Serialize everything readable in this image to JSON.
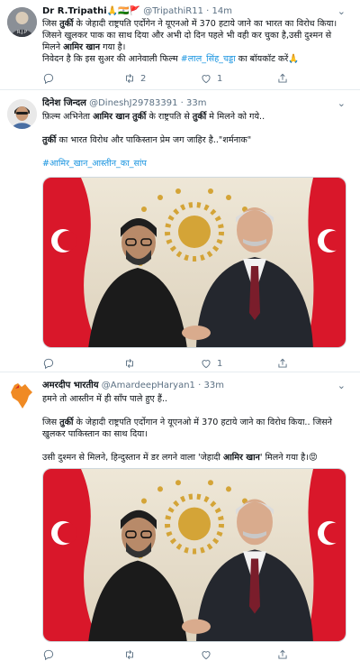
{
  "tweets": [
    {
      "name": "Dr R.Tripathi",
      "name_emoji": "🙏🇮🇳🚩",
      "handle": "@TripathiR11",
      "dot": "·",
      "time": "14m",
      "lines": [
        [
          "जिस ",
          {
            "b": "तुर्की"
          },
          " के जेहादी राष्ट्रपति एर्दोगेन ने यूएनओ में 370 हटाये जाने का भारत का विरोध किया।"
        ],
        [
          "जिसने खुलकर पाक का साथ दिया और अभी दो दिन पहले भी वही कर चुका है,उसी दुश्मन से"
        ],
        [
          "मिलने ",
          {
            "b": "आमिर खान"
          },
          " गया है।"
        ],
        [
          "निवेदन है कि इस सुअर की आनेवाली फिल्म ",
          {
            "hl": "#लाल_सिंह_चड्डा"
          },
          " का बॉयकॉट करें",
          {
            "e": "🙏"
          }
        ]
      ],
      "reply_count": "",
      "retweet_count": "2",
      "like_count": "1"
    },
    {
      "name": "दिनेश जिन्दल",
      "handle": "@DineshJ29783391",
      "dot": "·",
      "time": "33m",
      "lines": [
        [
          "फ़िल्म अभिनेता ",
          {
            "b": "आमिर खान"
          },
          " ",
          {
            "b": "तुर्की"
          },
          " के राष्ट्रपति से ",
          {
            "b": "तुर्की"
          },
          " मे मिलने को गये.."
        ],
        [
          ""
        ],
        [
          {
            "b": "तुर्की"
          },
          " का भारत विरोध और पाकिस्तान प्रेम जग जाहिर है..\"शर्मनाक\""
        ],
        [
          ""
        ],
        [
          {
            "hl": "#आमिर_खान_आस्तीन_का_सांप"
          }
        ]
      ],
      "reply_count": "",
      "retweet_count": "",
      "like_count": "1"
    },
    {
      "name": "अमरदीप भारतीय",
      "handle": "@AmardeepHaryan1",
      "dot": "·",
      "time": "33m",
      "lines": [
        [
          "हमने तो आस्तीन में ही साँप पाले हुए हैं.."
        ],
        [
          ""
        ],
        [
          "जिस ",
          {
            "b": "तुर्की"
          },
          " के जेहादी राष्ट्रपति एर्दोगान ने यूएनओ में 370 हटाये जाने का विरोध किया.. जिसने"
        ],
        [
          "खुलकर पाकिस्तान का साथ दिया।"
        ],
        [
          ""
        ],
        [
          "उसी दुश्मन से मिलने, हिन्दुस्तान में डर लगने वाला 'जेहादी ",
          {
            "b": "आमिर खान"
          },
          "' मिलने गया है।",
          {
            "e": "😡"
          }
        ]
      ],
      "reply_count": "",
      "retweet_count": "",
      "like_count": ""
    }
  ],
  "icons": {
    "reply": "reply-icon",
    "retweet": "retweet-icon",
    "like": "heart-icon",
    "share": "share-icon",
    "more": "chevron-down-icon"
  },
  "colors": {
    "hashtag": "#1b95e0",
    "secondary": "#5b7083",
    "flag_red": "#d9172a",
    "backdrop": "#ece6d8",
    "emblem_gold": "#d4a437"
  }
}
